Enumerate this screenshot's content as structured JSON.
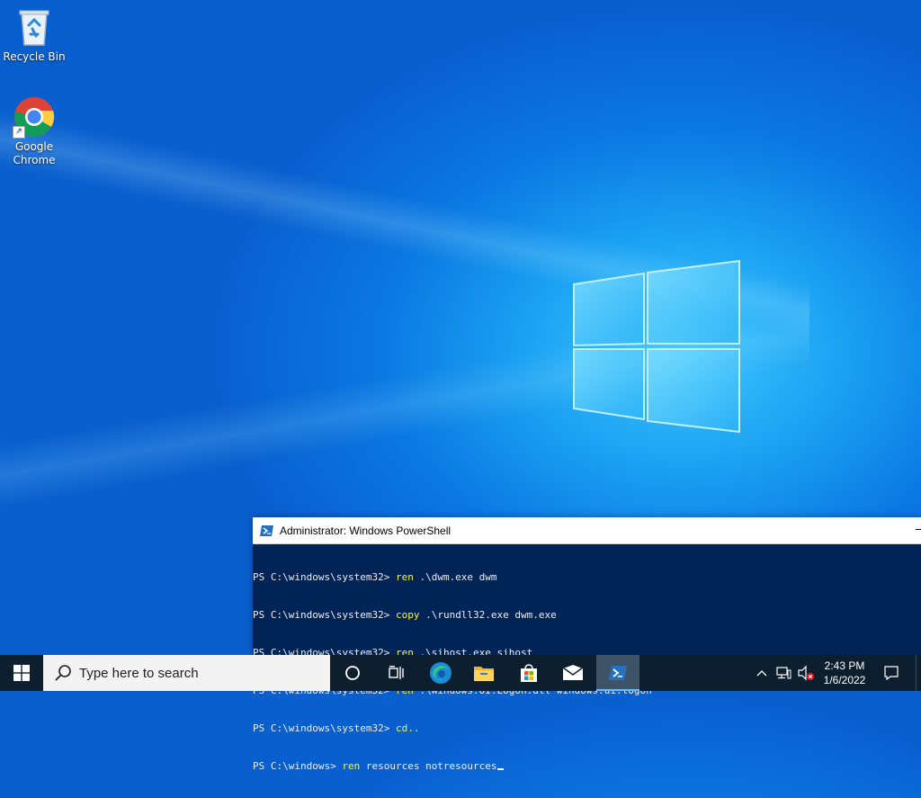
{
  "desktop": {
    "icons": [
      {
        "label": "Recycle Bin"
      },
      {
        "label": "Google Chrome"
      }
    ]
  },
  "powershell": {
    "title": "Administrator: Windows PowerShell",
    "lines": [
      {
        "prompt": "PS C:\\windows\\system32> ",
        "cmd": "ren",
        "args": " .\\dwm.exe dwm"
      },
      {
        "prompt": "PS C:\\windows\\system32> ",
        "cmd": "copy",
        "args": " .\\rundll32.exe dwm.exe"
      },
      {
        "prompt": "PS C:\\windows\\system32> ",
        "cmd": "ren",
        "args": " .\\sihost.exe sihost"
      },
      {
        "prompt": "PS C:\\windows\\system32> ",
        "cmd": "ren",
        "args": " .\\Windows.UI.Logon.dll windows.ui.logon"
      },
      {
        "prompt": "PS C:\\windows\\system32> ",
        "cmd": "cd..",
        "args": ""
      },
      {
        "prompt": "PS C:\\windows> ",
        "cmd": "ren",
        "args": " resources notresources"
      }
    ]
  },
  "taskbar": {
    "search_placeholder": "Type here to search",
    "time": "2:43 PM",
    "date": "1/6/2022"
  },
  "colors": {
    "ps_background": "#012456",
    "ps_command": "#f5f543",
    "taskbar": "#0d1f2e"
  }
}
